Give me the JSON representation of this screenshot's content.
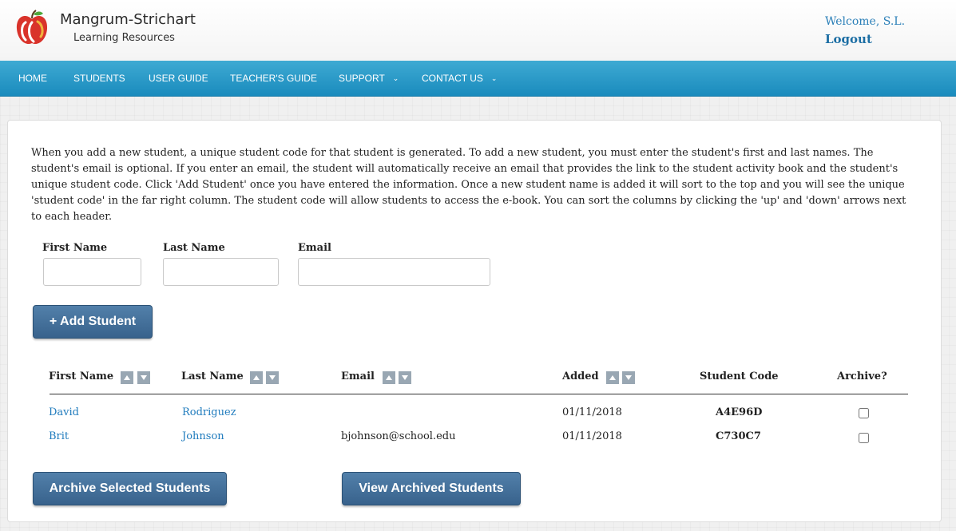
{
  "header": {
    "brand_name": "Mangrum-Strichart",
    "brand_sub": "Learning Resources",
    "welcome": "Welcome, S.L.",
    "logout": "Logout",
    "logo_icon": "apple-logo-icon"
  },
  "nav": {
    "items": [
      {
        "label": "HOME"
      },
      {
        "label": "STUDENTS"
      },
      {
        "label": "USER GUIDE"
      },
      {
        "label": "TEACHER'S GUIDE"
      },
      {
        "label": "SUPPORT",
        "icon": "chevron-down-icon"
      },
      {
        "label": "CONTACT US",
        "icon": "chevron-down-icon"
      }
    ]
  },
  "intro": "When you add a new student, a unique student code for that student is generated. To add a new student, you must enter the student's first and last names. The student's email is optional. If you enter an email, the student will automatically receive an email that provides the link to the student activity book and the student's unique student code. Click 'Add Student' once you have entered the information. Once a new student name is added it will sort to the top and you will see the unique 'student code' in the far right column. The student code will allow students to access the e-book. You can sort the columns by clicking the 'up' and 'down' arrows next to each header.",
  "form": {
    "first_name_label": "First Name",
    "first_name_value": "",
    "last_name_label": "Last Name",
    "last_name_value": "",
    "email_label": "Email",
    "email_value": "",
    "add_button": "+ Add Student"
  },
  "table": {
    "headers": {
      "first_name": "First Name",
      "last_name": "Last Name",
      "email": "Email",
      "added": "Added",
      "student_code": "Student Code",
      "archive": "Archive?"
    },
    "rows": [
      {
        "first": "David",
        "last": "Rodriguez",
        "email": "",
        "added": "01/11/2018",
        "code": "A4E96D",
        "archived": false
      },
      {
        "first": "Brit",
        "last": "Johnson",
        "email": "bjohnson@school.edu",
        "added": "01/11/2018",
        "code": "C730C7",
        "archived": false
      }
    ]
  },
  "actions": {
    "archive_selected": "Archive Selected Students",
    "view_archived": "View Archived Students"
  },
  "colors": {
    "nav_top": "#3eaad3",
    "nav_bottom": "#1a8bbd",
    "link": "#1f7bbd",
    "button": "#45709a"
  }
}
